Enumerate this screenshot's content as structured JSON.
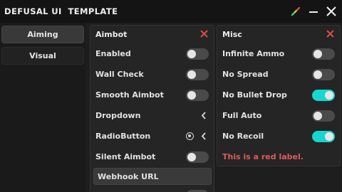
{
  "window": {
    "title": "DEFUSAL UI  TEMPLATE"
  },
  "titlebar_buttons": {
    "color_picker": "pen-color-icon",
    "minimize": "minimize-icon",
    "close": "close-icon"
  },
  "sidebar": {
    "tabs": [
      {
        "label": "Aiming",
        "active": true
      },
      {
        "label": "Visual",
        "active": false
      }
    ]
  },
  "left_panel": {
    "title": "Aimbot",
    "close_color": "#e04848",
    "rows": [
      {
        "label": "Enabled",
        "type": "toggle",
        "on": false
      },
      {
        "label": "Wall Check",
        "type": "toggle",
        "on": false
      },
      {
        "label": "Smooth Aimbot",
        "type": "toggle",
        "on": false
      },
      {
        "label": "Dropdown",
        "type": "dropdown"
      },
      {
        "label": "RadioButton",
        "type": "radio"
      },
      {
        "label": "Silent Aimbot",
        "type": "toggle",
        "on": false
      }
    ],
    "textbox": {
      "value": "Webhook URL"
    }
  },
  "right_panel": {
    "title": "Misc",
    "close_color": "#e04848",
    "rows": [
      {
        "label": "Infinite Ammo",
        "type": "toggle",
        "on": false
      },
      {
        "label": "No Spread",
        "type": "toggle",
        "on": false
      },
      {
        "label": "No Bullet Drop",
        "type": "toggle",
        "on": true
      },
      {
        "label": "Full Auto",
        "type": "toggle",
        "on": false
      },
      {
        "label": "No Recoil",
        "type": "toggle",
        "on": true
      }
    ],
    "red_label": "This is a red label.",
    "red_label_color": "#e05a5a"
  },
  "colors": {
    "accent_toggle_on": "#17d6cf",
    "toggle_off": "#4a4a4a"
  }
}
